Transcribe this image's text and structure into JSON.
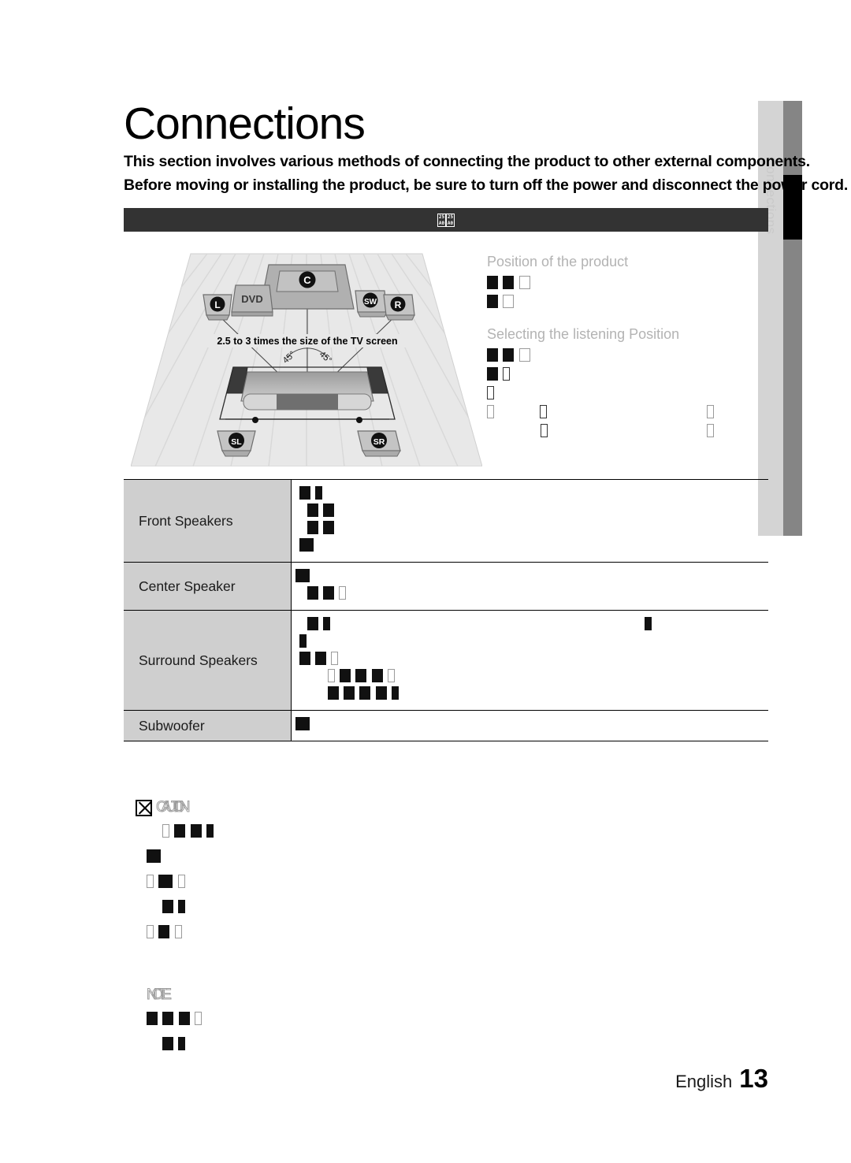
{
  "page": {
    "title": "Connections",
    "intro_line1": "This section involves various methods of connecting the product to other external components.",
    "intro_line2": "Before moving or installing the product, be sure to turn off the power and disconnect the power cord.",
    "side_tab_label": "Connections",
    "footer_language": "English",
    "footer_page_number": "13"
  },
  "banner": {
    "title_unrenderable": "☒☒",
    "glyph_count": 2
  },
  "diagram": {
    "caption": "2.5 to 3 times the size of the TV screen",
    "angle_left": "45°",
    "angle_right": "45°",
    "speakers": {
      "front_left": "L",
      "front_right": "R",
      "center": "C",
      "subwoofer": "SW",
      "surround_left": "SL",
      "surround_right": "SR",
      "player": "DVD"
    }
  },
  "text_column": {
    "heading_1": "Position of the product",
    "heading_2": "Selecting the listening Position",
    "body_unrenderable": true,
    "block_1_lines": [
      3,
      2
    ],
    "block_2_lines": [
      3,
      2,
      1
    ]
  },
  "table": {
    "rows": [
      {
        "label": "Front Speakers",
        "value_unrenderable": true,
        "line_count": 4
      },
      {
        "label": "Center Speaker",
        "value_unrenderable": true,
        "line_count": 2
      },
      {
        "label": "Surround Speakers",
        "value_unrenderable": true,
        "line_count": 5
      },
      {
        "label": "Subwoofer",
        "value_unrenderable": true,
        "line_count": 1
      }
    ]
  },
  "notices": [
    {
      "heading": "CAUTION",
      "icon": "x-box-icon",
      "line_count": 5,
      "body_unrenderable": true
    },
    {
      "heading": "NOTE",
      "icon": "none",
      "line_count": 2,
      "body_unrenderable": true
    }
  ],
  "colors": {
    "banner_bg": "#333333",
    "table_label_bg": "#cfcfcf",
    "side_tab_bg": "#d4d4d4",
    "side_bar_grey": "#858585",
    "side_bar_black": "#000000",
    "heading_grey": "#b3b3b3",
    "floor_grey": "#e8e8e8"
  }
}
